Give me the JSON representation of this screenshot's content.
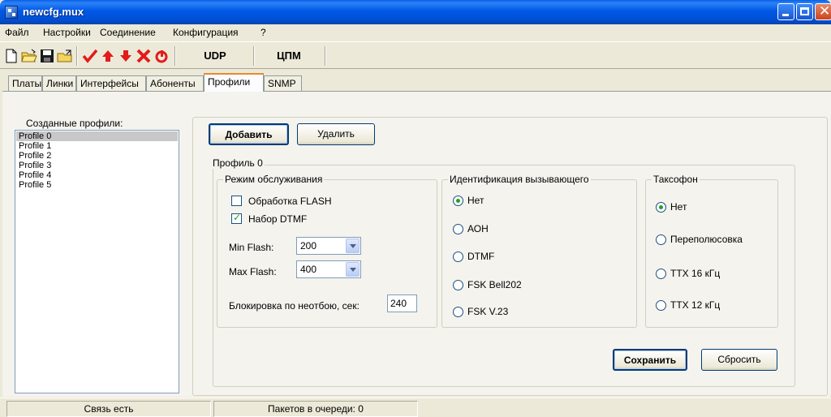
{
  "window": {
    "title": "newcfg.mux"
  },
  "menu": [
    "Файл",
    "Настройки",
    "Соединение",
    "Конфигурация",
    "?"
  ],
  "toolbar": {
    "icons": [
      "new-file-icon",
      "open-folder-icon",
      "save-icon",
      "open-file-icon",
      "check-icon",
      "arrow-up-icon",
      "arrow-down-icon",
      "delete-icon",
      "reload-icon"
    ],
    "udp_label": "UDP",
    "cpm_label": "ЦПМ"
  },
  "tabs": [
    "Платы",
    "Линки",
    "Интерфейсы",
    "Абоненты",
    "Профили",
    "SNMP"
  ],
  "active_tab": "Профили",
  "profiles": {
    "list_label": "Созданные профили:",
    "items": [
      "Profile 0",
      "Profile 1",
      "Profile 2",
      "Profile 3",
      "Profile 4",
      "Profile 5"
    ],
    "selected": "Profile 0"
  },
  "actions": {
    "add": "Добавить",
    "delete": "Удалить",
    "save": "Сохранить",
    "reset": "Сбросить"
  },
  "profile_group": {
    "title": "Профиль 0"
  },
  "service_mode": {
    "title": "Режим обслуживания",
    "flash_label": "Обработка FLASH",
    "flash_checked": false,
    "dtmf_label": "Набор DTMF",
    "dtmf_checked": true,
    "min_flash_label": "Min Flash:",
    "min_flash_value": "200",
    "max_flash_label": "Max Flash:",
    "max_flash_value": "400",
    "block_label": "Блокировка по неотбою, сек:",
    "block_value": "240"
  },
  "caller_id": {
    "title": "Идентификация вызывающего",
    "options": [
      "Нет",
      "АОН",
      "DTMF",
      "FSK Bell202",
      "FSK V.23"
    ],
    "selected": "Нет"
  },
  "payphone": {
    "title": "Таксофон",
    "options": [
      "Нет",
      "Переполюсовка",
      "ТТХ 16 кГц",
      "ТТХ 12 кГц"
    ],
    "selected": "Нет"
  },
  "status": {
    "connection": "Связь есть",
    "queue": "Пакетов в очереди: 0"
  }
}
